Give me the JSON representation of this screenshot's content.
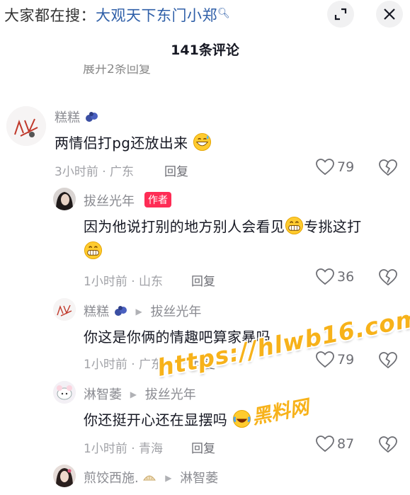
{
  "search": {
    "prefix": "大家都在搜：",
    "term": "大观天下东门小郑",
    "icon": "search-icon"
  },
  "header": {
    "comment_count_title": "141条评论",
    "expand_icon": "expand-icon",
    "close_icon": "close-icon"
  },
  "partial_row": "展开2条回复",
  "comments": [
    {
      "username": "糕糕",
      "text": "两情侣打pg还放出来",
      "time_location": "3小时前 · 广东",
      "reply_label": "回复",
      "likes": "79"
    },
    {
      "username": "拔丝光年",
      "badge": "作者",
      "text_line1": "因为他说打别的地方别人会看见",
      "text_line1_tail": "专挑这打",
      "time_location": "1小时前 · 山东",
      "reply_label": "回复",
      "likes": "36"
    },
    {
      "username": "糕糕",
      "reply_to": "拔丝光年",
      "text": "你这是你俩的情趣吧算家暴吗",
      "time_location": "1小时前 · 广东",
      "reply_label": "回复",
      "likes": "79"
    },
    {
      "username": "淋智萎",
      "reply_to": "拔丝光年",
      "text": "你还挺开心还在显摆吗",
      "time_location": "1小时前 · 青海",
      "reply_label": "回复",
      "likes": "87"
    },
    {
      "username": "煎饺西施.",
      "reply_to": "淋智萎"
    }
  ],
  "watermark": {
    "url": "https://hlwb16.com",
    "name": "黑料网"
  },
  "colors": {
    "search_term": "#2f5fa8",
    "author_badge": "#fe2c55",
    "watermark": "#f7b21a"
  }
}
